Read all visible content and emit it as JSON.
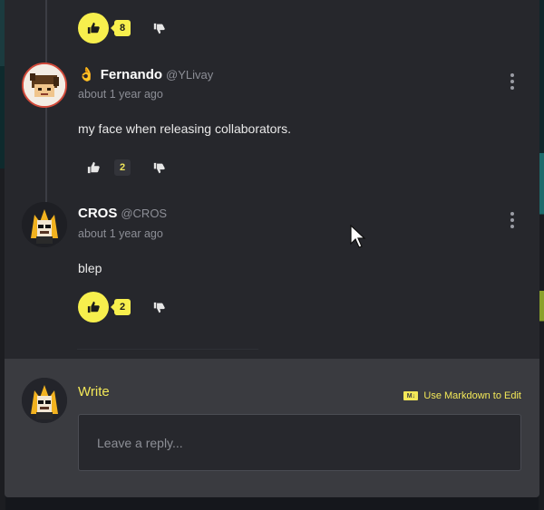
{
  "top_vote": {
    "count": "8"
  },
  "comments": [
    {
      "emoji": "👌",
      "name": "Fernando",
      "handle": "@YLivay",
      "time": "about 1 year ago",
      "text": "my face when releasing collaborators.",
      "votes": "2"
    },
    {
      "name": "CROS",
      "handle": "@CROS",
      "time": "about 1 year ago",
      "text": "blep",
      "votes": "2"
    }
  ],
  "reply": {
    "title": "Write",
    "markdown_badge": "M↓",
    "markdown_hint": "Use Markdown to Edit",
    "placeholder": "Leave a reply..."
  },
  "colors": {
    "accent": "#f7ef4d",
    "panel": "#26272c",
    "reply_bg": "#3a3b40"
  },
  "icons": [
    "thumbs-up-icon",
    "thumbs-down-icon",
    "more-vertical-icon",
    "markdown-icon",
    "mouse-cursor-icon"
  ]
}
